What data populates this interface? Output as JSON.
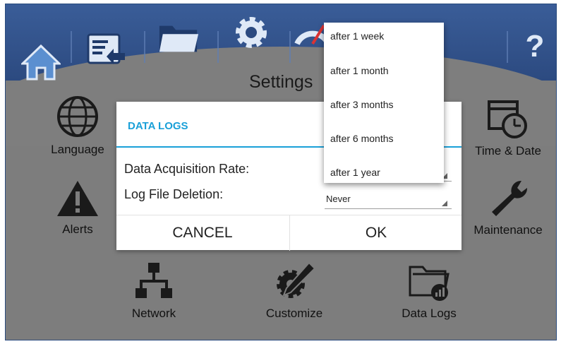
{
  "header": {
    "title": "Settings",
    "icons": [
      "home-icon",
      "screen-import-icon",
      "folder-icon",
      "gear-icon",
      "gauge-icon",
      "usb-icon",
      "help-icon"
    ],
    "help_label": "?"
  },
  "apps": [
    {
      "label": "Language",
      "icon": "globe-icon"
    },
    {
      "label": "Time & Date",
      "icon": "calendar-clock-icon"
    },
    {
      "label": "Alerts",
      "icon": "warning-icon"
    },
    {
      "label": "Maintenance",
      "icon": "wrench-icon"
    },
    {
      "label": "Network",
      "icon": "network-icon"
    },
    {
      "label": "Customize",
      "icon": "customize-icon"
    },
    {
      "label": "Data Logs",
      "icon": "folder-chart-icon"
    }
  ],
  "dialog": {
    "title": "DATA LOGS",
    "rows": [
      {
        "label": "Data Acquisition Rate:",
        "value": ""
      },
      {
        "label": "Log File Deletion:",
        "value": "Never"
      }
    ],
    "cancel_label": "CANCEL",
    "ok_label": "OK"
  },
  "dropdown": {
    "options": [
      "after 1 week",
      "after 1 month",
      "after 3 months",
      "after 6 months",
      "after 1 year"
    ]
  },
  "colors": {
    "header_blue": "#2f4f87",
    "accent": "#1aa0d8",
    "background": "#7d7d7d"
  }
}
